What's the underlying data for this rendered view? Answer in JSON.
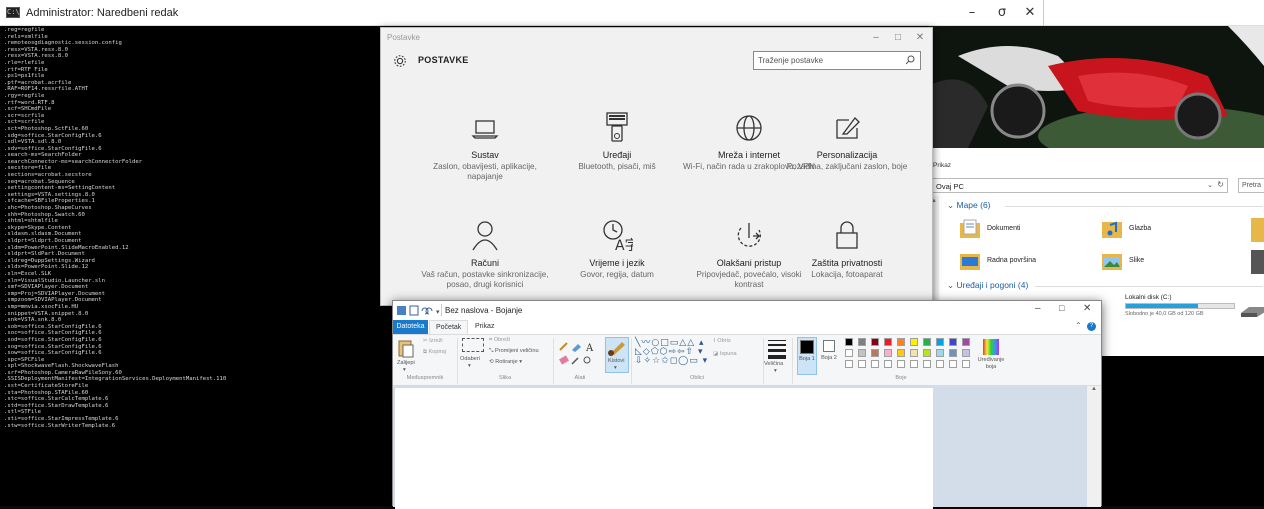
{
  "cmd": {
    "title": "Administrator: Naredbeni redak",
    "minimize": "–",
    "maximize": "σ",
    "close": "✕",
    "lines": [
      ".reg=regfile",
      ".rels=xmlfile",
      ".remoteosgdiagnostic.session.config",
      ".resx=VSTA.resx.8.0",
      ".resx=VSTA.resx.8.0",
      ".rle=rlefile",
      ".rtf=RTF File",
      ".ps1=ps1file",
      ".ptf=acrobat.acrfile",
      ".RAF=ROF14.ressrfile.ATHT",
      ".rgy=regfile",
      ".rtf=word.RTF.8",
      ".scf=SHCmdFile",
      ".scr=scrfile",
      ".sct=scrfile",
      ".sct=Photoshop.SctFile.60",
      ".sdg=soffice.StarConfigFile.6",
      ".sdl=VSTA.sdl.8.0",
      ".sdv=soffice.StarConfigFile.6",
      ".search-ms=SearchFolder",
      ".searchConnector-ms=searchConnectorFolder",
      ".secstore=file",
      ".sections=acrobat.secstore",
      ".seq=acrobat.Sequence",
      ".settingcontent-ms=SettingContent",
      ".settings=VSTA.settings.8.0",
      ".sfcache=SBFileProperties.1",
      ".shc=Photoshop.ShapeCurves",
      ".shh=Photoshop.Swatch.60",
      ".shtml=shtmlfile",
      ".skype=Skype.Content",
      ".sldasm.sldasm.Document",
      ".sldprt=Sldprt.Document",
      ".sldm=PowerPoint.SlideMacroEnabled.12",
      ".sldprt=SldPart.Document",
      ".sldreg=DuppSettings.Wizard",
      ".sldx=PowerPoint.Slide.12",
      ".sln=Excel.SLK",
      ".sln=VisualStudio.Launcher.sln",
      ".smf=SDVIAPlayer.Document",
      ".smp=Proj=SDVIAPlayer.Document",
      ".smpzoom=SDVIAPlayer.Document",
      ".smp=mmvia.xsocFile.HU",
      ".snippet=VSTA.snippet.8.0",
      ".snk=VSTA.snk.8.0",
      ".sob=soffice.StarConfigFile.6",
      ".soc=soffice.StarConfigFile.6",
      ".sod=soffice.StarConfigFile.6",
      ".sog=soffice.StarConfigFile.6",
      ".sow=soffice.StarConfigFile.6",
      ".spc=SPCFile",
      ".spl=ShockwaveFlash.ShockwaveFlash",
      ".srf=Photoshop.CameraRawFileSony.60",
      ".SSISDeploymentManifest=IntegrationServices.DeploymentManifest.110",
      ".sst=CertificateStoreFile",
      ".sta=Photoshop.STAFile.60",
      ".stc=soffice.StarCalcTemplate.6",
      ".std=soffice.StarDrawTemplate.6",
      ".stl=STFile",
      ".sti=soffice.StarImpressTemplate.6",
      ".stw=soffice.StarWriterTemplate.6"
    ]
  },
  "settings": {
    "window_title": "Postavke",
    "heading": "POSTAVKE",
    "search_placeholder": "Traženje postavke",
    "tiles": [
      {
        "name": "Sustav",
        "desc": "Zaslon, obavijesti, aplikacije, napajanje",
        "icon": "laptop-icon"
      },
      {
        "name": "Uređaji",
        "desc": "Bluetooth, pisači, miš",
        "icon": "devices-icon"
      },
      {
        "name": "Mreža i internet",
        "desc": "Wi-Fi, način rada u zrakoplovu, VPN",
        "icon": "globe-icon"
      },
      {
        "name": "Personalizacija",
        "desc": "Pozadina, zaključani zaslon, boje",
        "icon": "brush-icon"
      },
      {
        "name": "Računi",
        "desc": "Vaš račun, postavke sinkronizacije, posao, drugi korisnici",
        "icon": "person-icon"
      },
      {
        "name": "Vrijeme i jezik",
        "desc": "Govor, regija, datum",
        "icon": "time-language-icon"
      },
      {
        "name": "Olakšani pristup",
        "desc": "Pripovjedač, povećalo, visoki kontrast",
        "icon": "ease-of-access-icon"
      },
      {
        "name": "Zaštita privatnosti",
        "desc": "Lokacija, fotoaparat",
        "icon": "lock-icon"
      }
    ]
  },
  "explorer": {
    "view_label": "Prikaz",
    "address": "Ovaj PC",
    "search_label": "Pretra",
    "folders_group": "Mape (6)",
    "folders": [
      {
        "name": "Dokumenti",
        "icon": "documents-folder-icon"
      },
      {
        "name": "Glazba",
        "icon": "music-folder-icon"
      },
      {
        "name": "Radna površina",
        "icon": "desktop-folder-icon"
      },
      {
        "name": "Slike",
        "icon": "pictures-folder-icon"
      }
    ],
    "drives_group": "Uređaji i pogoni (4)",
    "drive": {
      "name": "Lokalni disk (C:)",
      "free": "Slobodno je 40,0 GB od 120 GB",
      "used_fraction": 0.67
    }
  },
  "paint": {
    "title": "Bez naslova - Bojanje",
    "tab_file": "Datoteka",
    "tab_start": "Početak",
    "tab_view": "Prikaz",
    "clipboard": {
      "paste": "Zalijepi",
      "cut": "Izreži",
      "copy": "Kopiraj",
      "title": "Međuspremnik"
    },
    "image": {
      "select": "Odaberi",
      "crop": "Obreži",
      "resize": "Promijeni veličinu",
      "rotate": "Rotiranje",
      "title": "Slika"
    },
    "tools": {
      "title": "Alati",
      "brushes": "Kistovi"
    },
    "shapes": {
      "outline": "Obris",
      "fill": "Ispuna",
      "title": "Oblici"
    },
    "size_label": "Veličina",
    "color1_label": "Boja 1",
    "color2_label": "Boja 2",
    "edit_colors": "Uređivanje boja",
    "colors_title": "Boje",
    "palette_row1": [
      "#000000",
      "#7f7f7f",
      "#880015",
      "#ed1c24",
      "#ff7f27",
      "#fff200",
      "#22b14c",
      "#00a2e8",
      "#3f48cc",
      "#a349a4"
    ],
    "palette_row2": [
      "#ffffff",
      "#c3c3c3",
      "#b97a57",
      "#ffaec9",
      "#ffc90e",
      "#efe4b0",
      "#b5e61d",
      "#99d9ea",
      "#7092be",
      "#c8bfe7"
    ]
  }
}
